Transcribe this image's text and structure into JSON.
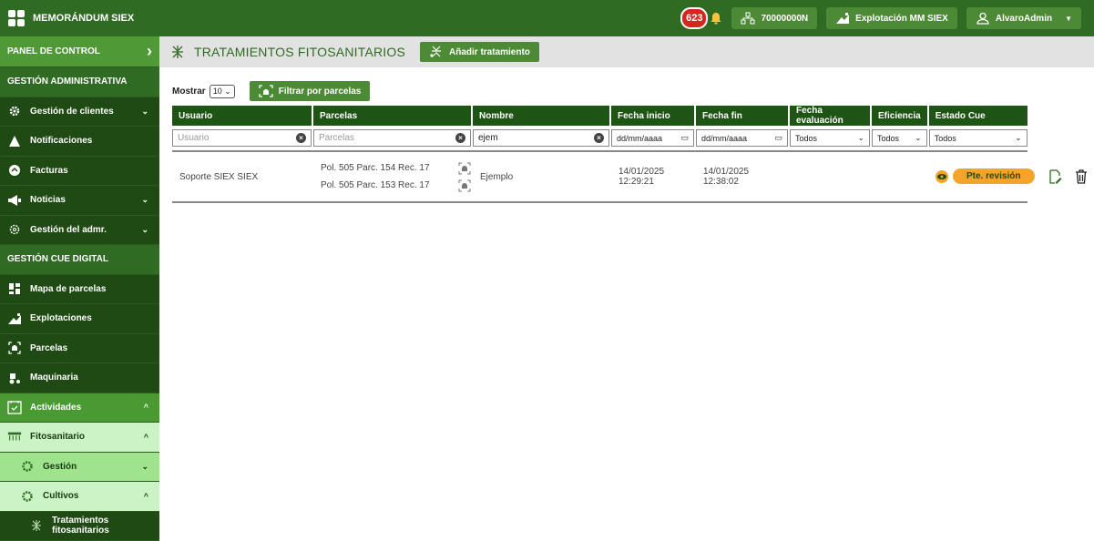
{
  "app": {
    "title": "MEMORÁNDUM SIEX"
  },
  "topbar": {
    "notif_count": "623",
    "account_id": "70000000N",
    "explotacion": "Explotación MM SIEX",
    "user": "AlvaroAdmin"
  },
  "sidebar": {
    "panel": "PANEL DE CONTROL",
    "section1": "GESTIÓN ADMINISTRATIVA",
    "items1": [
      {
        "label": "Gestión de clientes",
        "icon": "gear-icon"
      },
      {
        "label": "Notificaciones",
        "icon": "alert-icon"
      },
      {
        "label": "Facturas",
        "icon": "invoice-icon"
      },
      {
        "label": "Noticias",
        "icon": "megaphone-icon"
      },
      {
        "label": "Gestión del admr.",
        "icon": "gear-icon"
      }
    ],
    "section2": "GESTIÓN CUE DIGITAL",
    "items2": [
      {
        "label": "Mapa de parcelas",
        "icon": "map-icon"
      },
      {
        "label": "Explotaciones",
        "icon": "farm-icon"
      },
      {
        "label": "Parcelas",
        "icon": "parcel-icon"
      },
      {
        "label": "Maquinaria",
        "icon": "tractor-icon"
      }
    ],
    "actividades": "Actividades",
    "fitosanitario": "Fitosanitario",
    "gestion": "Gestión",
    "cultivos": "Cultivos",
    "tratamientos": "Tratamientos fitosanitarios"
  },
  "main": {
    "title": "TRATAMIENTOS FITOSANITARIOS",
    "add_label": "Añadir tratamiento",
    "mostrar_label": "Mostrar",
    "mostrar_value": "10",
    "filter_label": "Filtrar por parcelas"
  },
  "table": {
    "headers": [
      "Usuario",
      "Parcelas",
      "Nombre",
      "Fecha inicio",
      "Fecha fin",
      "Fecha evaluación",
      "Eficiencia",
      "Estado Cue"
    ],
    "filters": {
      "usuario_placeholder": "Usuario",
      "parcelas_placeholder": "Parcelas",
      "nombre_value": "ejem",
      "fecha_inicio_placeholder": "dd/mm/aaaa",
      "fecha_fin_placeholder": "dd/mm/aaaa",
      "fecha_eval": "Todos",
      "eficiencia": "Todos",
      "estado": "Todos"
    },
    "rows": [
      {
        "usuario": "Soporte SIEX SIEX",
        "parcelas": [
          "Pol. 505 Parc. 154 Rec. 17",
          "Pol. 505 Parc. 153 Rec. 17"
        ],
        "nombre": "Ejemplo",
        "fecha_inicio": [
          "14/01/2025",
          "12:29:21"
        ],
        "fecha_fin": [
          "14/01/2025",
          "12:38:02"
        ],
        "estado": "Pte. revisión"
      }
    ]
  },
  "colors": {
    "brand": "#2f6b22",
    "sidebar": "#1f4a13",
    "status": "#f4a42a"
  }
}
